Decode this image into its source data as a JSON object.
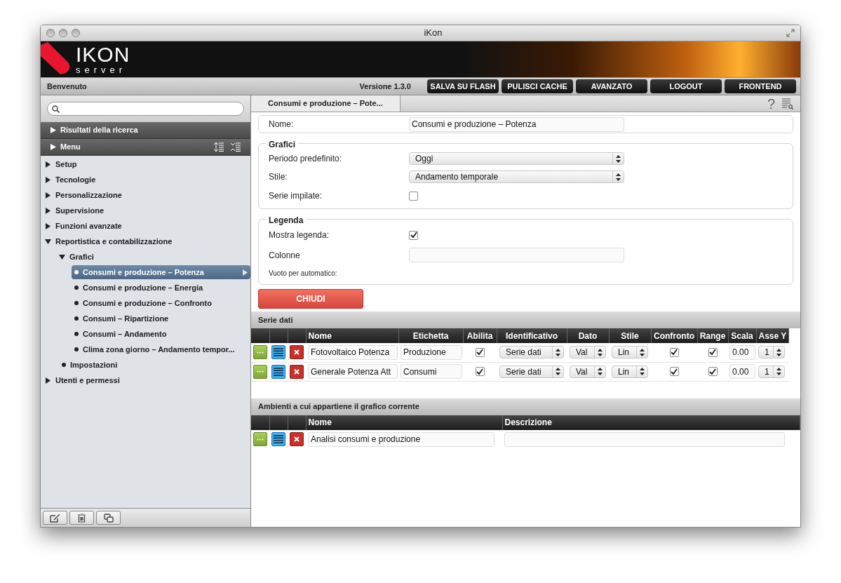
{
  "window": {
    "title": "iKon"
  },
  "logo": {
    "mark": "IKON",
    "sub": "server"
  },
  "toolbar": {
    "welcome": "Benvenuto",
    "version": "Versione 1.3.0",
    "buttons": [
      "SALVA SU FLASH",
      "PULISCI CACHE",
      "AVANZATO",
      "LOGOUT",
      "FRONTEND"
    ]
  },
  "sidebar": {
    "sections": [
      {
        "label": "Risultati della ricerca",
        "expanded": false
      },
      {
        "label": "Menu",
        "expanded": false
      }
    ],
    "tree": [
      {
        "label": "Setup",
        "expanded": false,
        "selected": false
      },
      {
        "label": "Tecnologie",
        "expanded": false,
        "selected": false
      },
      {
        "label": "Personalizzazione",
        "expanded": false,
        "selected": false
      },
      {
        "label": "Supervisione",
        "expanded": false,
        "selected": false
      },
      {
        "label": "Funzioni avanzate",
        "expanded": false,
        "selected": false
      },
      {
        "label": "Reportistica e contabilizzazione",
        "expanded": true,
        "selected": false,
        "children": [
          {
            "label": "Grafici",
            "expanded": true,
            "selected": false,
            "children": [
              {
                "label": "Consumi e produzione – Potenza",
                "selected": true
              },
              {
                "label": "Consumi e produzione – Energia",
                "selected": false
              },
              {
                "label": "Consumi e produzione – Confronto",
                "selected": false
              },
              {
                "label": "Consumi – Ripartizione",
                "selected": false
              },
              {
                "label": "Consumi – Andamento",
                "selected": false
              },
              {
                "label": "Clima zona giorno – Andamento tempor...",
                "selected": false
              }
            ]
          },
          {
            "label": "Impostazioni",
            "selected": false
          }
        ]
      },
      {
        "label": "Utenti e permessi",
        "expanded": false,
        "selected": false
      }
    ]
  },
  "tab": {
    "label": "Consumi e produzione – Pote...",
    "selected": true
  },
  "help": "?",
  "form": {
    "name_label": "Nome:",
    "name_value": "Consumi e produzione – Potenza",
    "grafici": {
      "legend": "Grafici",
      "period_label": "Periodo predefinito:",
      "period_value": "Oggi",
      "style_label": "Stile:",
      "style_value": "Andamento temporale",
      "stacked_label": "Serie impilate:",
      "stacked": false
    },
    "legenda": {
      "legend": "Legenda",
      "show_label": "Mostra legenda:",
      "show": true,
      "columns_label": "Colonne",
      "hint": "Vuoto per automatico:"
    },
    "close_button": "CHIUDI"
  },
  "series": {
    "title": "Serie dati",
    "columns": [
      "Nome",
      "Etichetta",
      "Abilita",
      "Identificativo",
      "Dato",
      "Stile",
      "Confronto",
      "Range",
      "Scala",
      "Asse Y"
    ],
    "rows": [
      {
        "name": "Fotovoltaico Potenza",
        "label": "Produzione",
        "enabled": true,
        "id": "Serie dati",
        "data": "Val",
        "style": "Lin",
        "compare": true,
        "range": true,
        "scale": "0.00",
        "axis": "1"
      },
      {
        "name": "Generale Potenza Att",
        "label": "Consumi",
        "enabled": true,
        "id": "Serie dati",
        "data": "Val",
        "style": "Lin",
        "compare": true,
        "range": true,
        "scale": "0.00",
        "axis": "1"
      }
    ]
  },
  "environments": {
    "title": "Ambienti a cui appartiene il grafico corrente",
    "columns": [
      "Nome",
      "Descrizione"
    ],
    "rows": [
      {
        "name": "Analisi consumi e produzione"
      }
    ]
  }
}
